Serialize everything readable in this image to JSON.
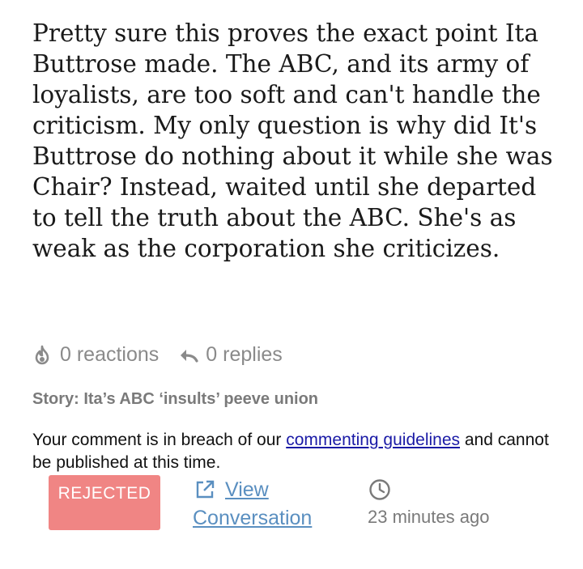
{
  "comment": {
    "text": "Pretty sure this proves the exact point Ita Buttrose made. The ABC, and its army of loyalists, are too soft and can't handle the criticism. My only question is why did It's Buttrose do nothing about it while she was Chair? Instead, waited until she departed to tell the truth about the ABC. She's as weak as the corporation she criticizes."
  },
  "meta": {
    "reactions": "0 reactions",
    "replies": "0 replies",
    "reactions_icon": "flame-icon",
    "replies_icon": "reply-arrow-icon"
  },
  "story": {
    "label": "Story: Ita’s ABC ‘insults’ peeve union"
  },
  "notice": {
    "before": "Your comment is in breach of our ",
    "link": "commenting guidelines",
    "after": " and cannot be published at this time."
  },
  "status": {
    "badge": "REJECTED",
    "badge_color": "#f08584",
    "view_link": "View Conversation",
    "link_color": "#5a8fc0",
    "time": "23 minutes ago",
    "time_icon": "clock-icon"
  }
}
